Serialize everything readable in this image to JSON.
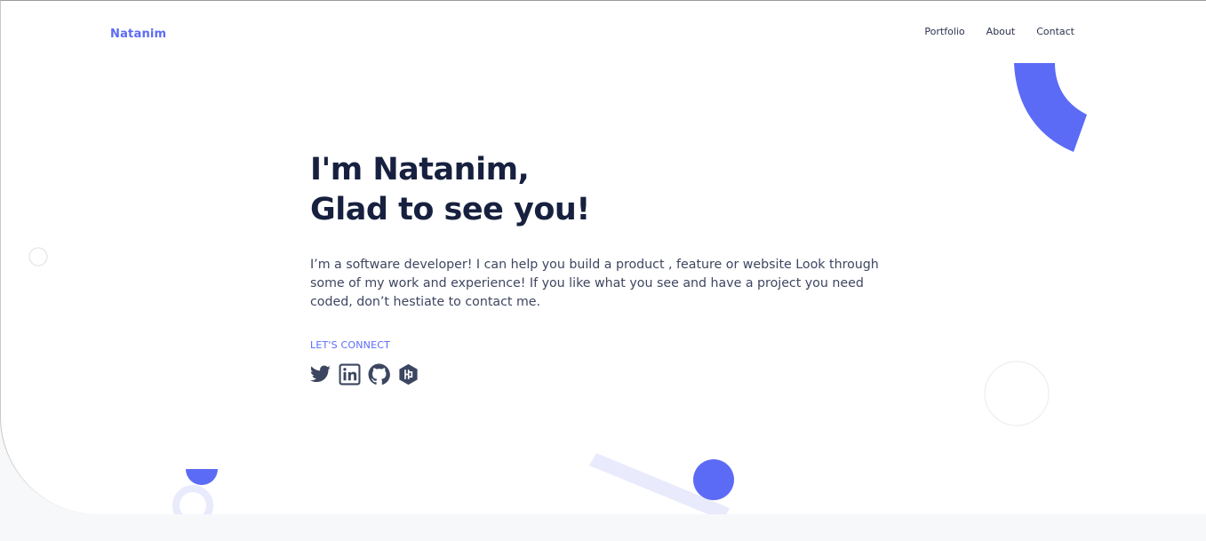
{
  "brand": {
    "name": "Natanim"
  },
  "nav": {
    "items": [
      "Portfolio",
      "About",
      "Contact"
    ]
  },
  "hero": {
    "headline_line1": "I'm Natanim,",
    "headline_line2": "Glad to see you!",
    "intro": "I’m a software developer! I can help you build a product , feature or website Look through some of my work and experience! If you like what you see and have a project you need coded, don’t hestiate to contact me.",
    "connect_label": "LET'S CONNECT"
  },
  "socials": [
    {
      "icon": "twitter-icon"
    },
    {
      "icon": "linkedin-icon"
    },
    {
      "icon": "github-icon"
    },
    {
      "icon": "hashnode-icon"
    }
  ],
  "colors": {
    "accent": "#5c6bf5",
    "heading": "#17213f",
    "body_text": "#3e4660",
    "icon": "#3c4660",
    "accent_light": "#e9eafc"
  }
}
